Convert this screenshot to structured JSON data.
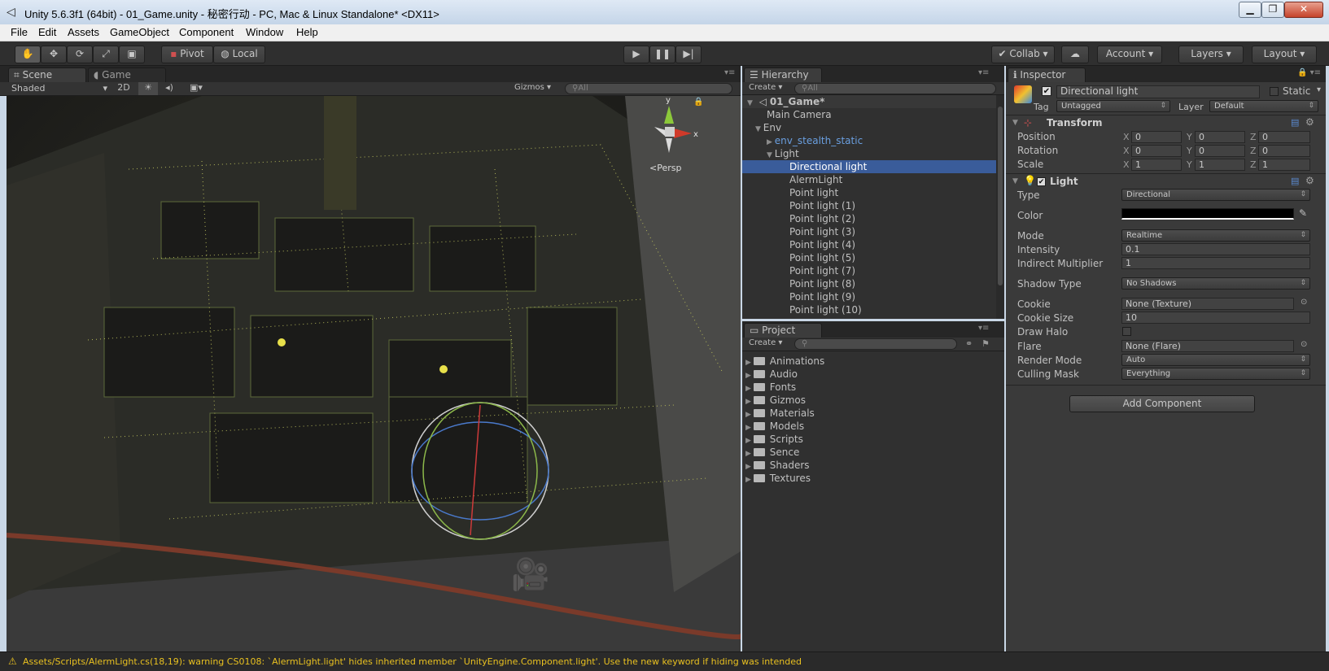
{
  "window": {
    "title": "Unity 5.6.3f1 (64bit) - 01_Game.unity - 秘密行动 - PC, Mac & Linux Standalone* <DX11>",
    "controls": [
      "▁",
      "❐",
      "✕"
    ]
  },
  "menu": [
    "File",
    "Edit",
    "Assets",
    "GameObject",
    "Component",
    "Window",
    "Help"
  ],
  "toolbar": {
    "pivot": "Pivot",
    "local": "Local",
    "collab": "Collab",
    "account": "Account",
    "layers": "Layers",
    "layout": "Layout"
  },
  "scene": {
    "tab_scene": "Scene",
    "tab_game": "Game",
    "shading": "Shaded",
    "mode2d": "2D",
    "gizmos": "Gizmos",
    "search_placeholder": "All",
    "persp": "Persp",
    "gizmo_y": "y",
    "gizmo_x": "x"
  },
  "hierarchy": {
    "tab": "Hierarchy",
    "create": "Create",
    "search_placeholder": "All",
    "scene_name": "01_Game*",
    "items": [
      "Main Camera",
      "Env",
      "env_stealth_static",
      "Light",
      "Directional light",
      "AlermLight",
      "Point light",
      "Point light (1)",
      "Point light (2)",
      "Point light (3)",
      "Point light (4)",
      "Point light (5)",
      "Point light (7)",
      "Point light (8)",
      "Point light (9)",
      "Point light (10)"
    ],
    "selected": "Directional light"
  },
  "project": {
    "tab": "Project",
    "create": "Create",
    "folders": [
      "Animations",
      "Audio",
      "Fonts",
      "Gizmos",
      "Materials",
      "Models",
      "Scripts",
      "Sence",
      "Shaders",
      "Textures"
    ]
  },
  "inspector": {
    "tab": "Inspector",
    "object_name": "Directional light",
    "static_label": "Static",
    "tag_label": "Tag",
    "tag_value": "Untagged",
    "layer_label": "Layer",
    "layer_value": "Default",
    "transform": {
      "title": "Transform",
      "rows": [
        {
          "label": "Position",
          "x": "0",
          "y": "0",
          "z": "0"
        },
        {
          "label": "Rotation",
          "x": "0",
          "y": "0",
          "z": "0"
        },
        {
          "label": "Scale",
          "x": "1",
          "y": "1",
          "z": "1"
        }
      ]
    },
    "light": {
      "title": "Light",
      "type_label": "Type",
      "type_value": "Directional",
      "color_label": "Color",
      "mode_label": "Mode",
      "mode_value": "Realtime",
      "intensity_label": "Intensity",
      "intensity_value": "0.1",
      "indirect_label": "Indirect Multiplier",
      "indirect_value": "1",
      "shadow_label": "Shadow Type",
      "shadow_value": "No Shadows",
      "cookie_label": "Cookie",
      "cookie_value": "None (Texture)",
      "cookie_size_label": "Cookie Size",
      "cookie_size_value": "10",
      "halo_label": "Draw Halo",
      "flare_label": "Flare",
      "flare_value": "None (Flare)",
      "render_mode_label": "Render Mode",
      "render_mode_value": "Auto",
      "culling_label": "Culling Mask",
      "culling_value": "Everything"
    },
    "add_component": "Add Component"
  },
  "status": {
    "message": "Assets/Scripts/AlermLight.cs(18,19): warning CS0108: `AlermLight.light' hides inherited member `UnityEngine.Component.light'. Use the new keyword if hiding was intended"
  },
  "colors": {
    "selection": "#3a5c9a",
    "warning": "#e8c020",
    "prefab_text": "#6a9fe0"
  }
}
